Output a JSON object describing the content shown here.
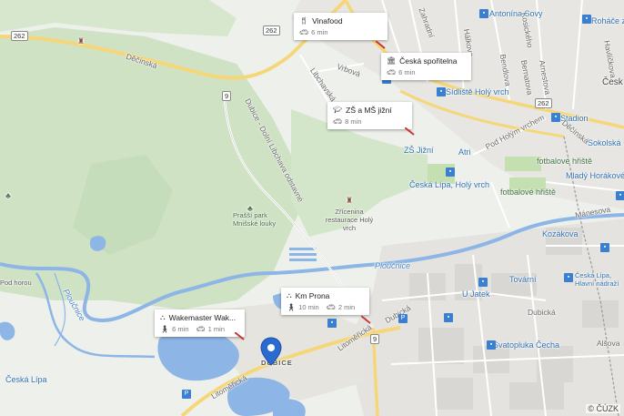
{
  "map": {
    "copyright": "© ČÚZK",
    "colors": {
      "water": "#8db5e6",
      "forest": "#cfe2c4",
      "road_main": "#f5d77a",
      "poi": "#3b7fd0"
    }
  },
  "cards": [
    {
      "id": "vinafood",
      "title": "Vinafood",
      "icon": "restaurant-icon",
      "travel": [
        {
          "mode": "car",
          "time": "6 min"
        }
      ]
    },
    {
      "id": "ceska-sporitelna",
      "title": "Česká spořitelna",
      "icon": "bank-icon",
      "travel": [
        {
          "mode": "car",
          "time": "6 min"
        }
      ]
    },
    {
      "id": "zs-ms-jizni",
      "title": "ZŠ a MŠ jižní",
      "icon": "school-icon",
      "travel": [
        {
          "mode": "car",
          "time": "8 min"
        }
      ]
    },
    {
      "id": "km-prona",
      "title": "Km Prona",
      "icon": "company-icon",
      "travel": [
        {
          "mode": "walk",
          "time": "10 min"
        },
        {
          "mode": "car",
          "time": "2 min"
        }
      ]
    },
    {
      "id": "wakemaster",
      "title": "Wakemaster Wak...",
      "icon": "company-icon",
      "travel": [
        {
          "mode": "walk",
          "time": "6 min"
        },
        {
          "mode": "car",
          "time": "1 min"
        }
      ]
    }
  ],
  "labels": {
    "decinska": "Děčínská",
    "zahradni": "Zahradní",
    "halkova": "Hálkova",
    "vrbova": "Vrbová",
    "libchavska": "Libchavská",
    "dubice_dolni": "Dubice - Dolní Libchava odstavné",
    "antonina_svehy": "Antonína Sovy",
    "kosickeho": "Kosického",
    "bendlova": "Bendlova",
    "bernatova": "Bernatova",
    "arnestova": "Arnestova",
    "havlickova": "Havlíčkova",
    "rohace": "Roháče z Dubé",
    "ceska_short": "Česk",
    "sidliste": "Sídliště Holý vrch",
    "pod_holym": "Pod Holým vrchem",
    "stadion": "Stadion",
    "sokolska": "Sokolská",
    "desinska2": "Děčínská",
    "fotbalove1": "fotbalové hřiště",
    "fotbalove2": "fotbalové hřiště",
    "mlady": "Mladý Horákové",
    "manesova": "Mánesova",
    "kozakova": "Kozákova",
    "zs_jizni": "ZŠ Jižní",
    "ceska_lipa_holy": "Česká Lípa, Holý vrch",
    "atri": "Atri",
    "zricenina": "Zřícenina restaurace Holý vrch",
    "prasi": "Prašší park Mnišské louky",
    "plucnice": "Ploučnice",
    "ploucnice_w": "Ploučnice",
    "dubicka": "Dubická",
    "dubicka2": "Dubická",
    "litomericka": "Litoměřická",
    "litomericka2": "Litoměřická",
    "dubice": "DUBICE",
    "tovarni": "Tovární",
    "u_jatek": "U Jatek",
    "svatopluka": "Svatopluka Čecha",
    "ceska_lipa_hlavni": "Česká Lípa, Hlavní nádraží",
    "alsova": "Alšova",
    "ceska_lipa_w": "Česká Lípa",
    "pr_horou": "Pod horou"
  },
  "shields": {
    "r262a": "262",
    "r262b": "262",
    "r262c": "262",
    "r9a": "9",
    "r9b": "9"
  }
}
